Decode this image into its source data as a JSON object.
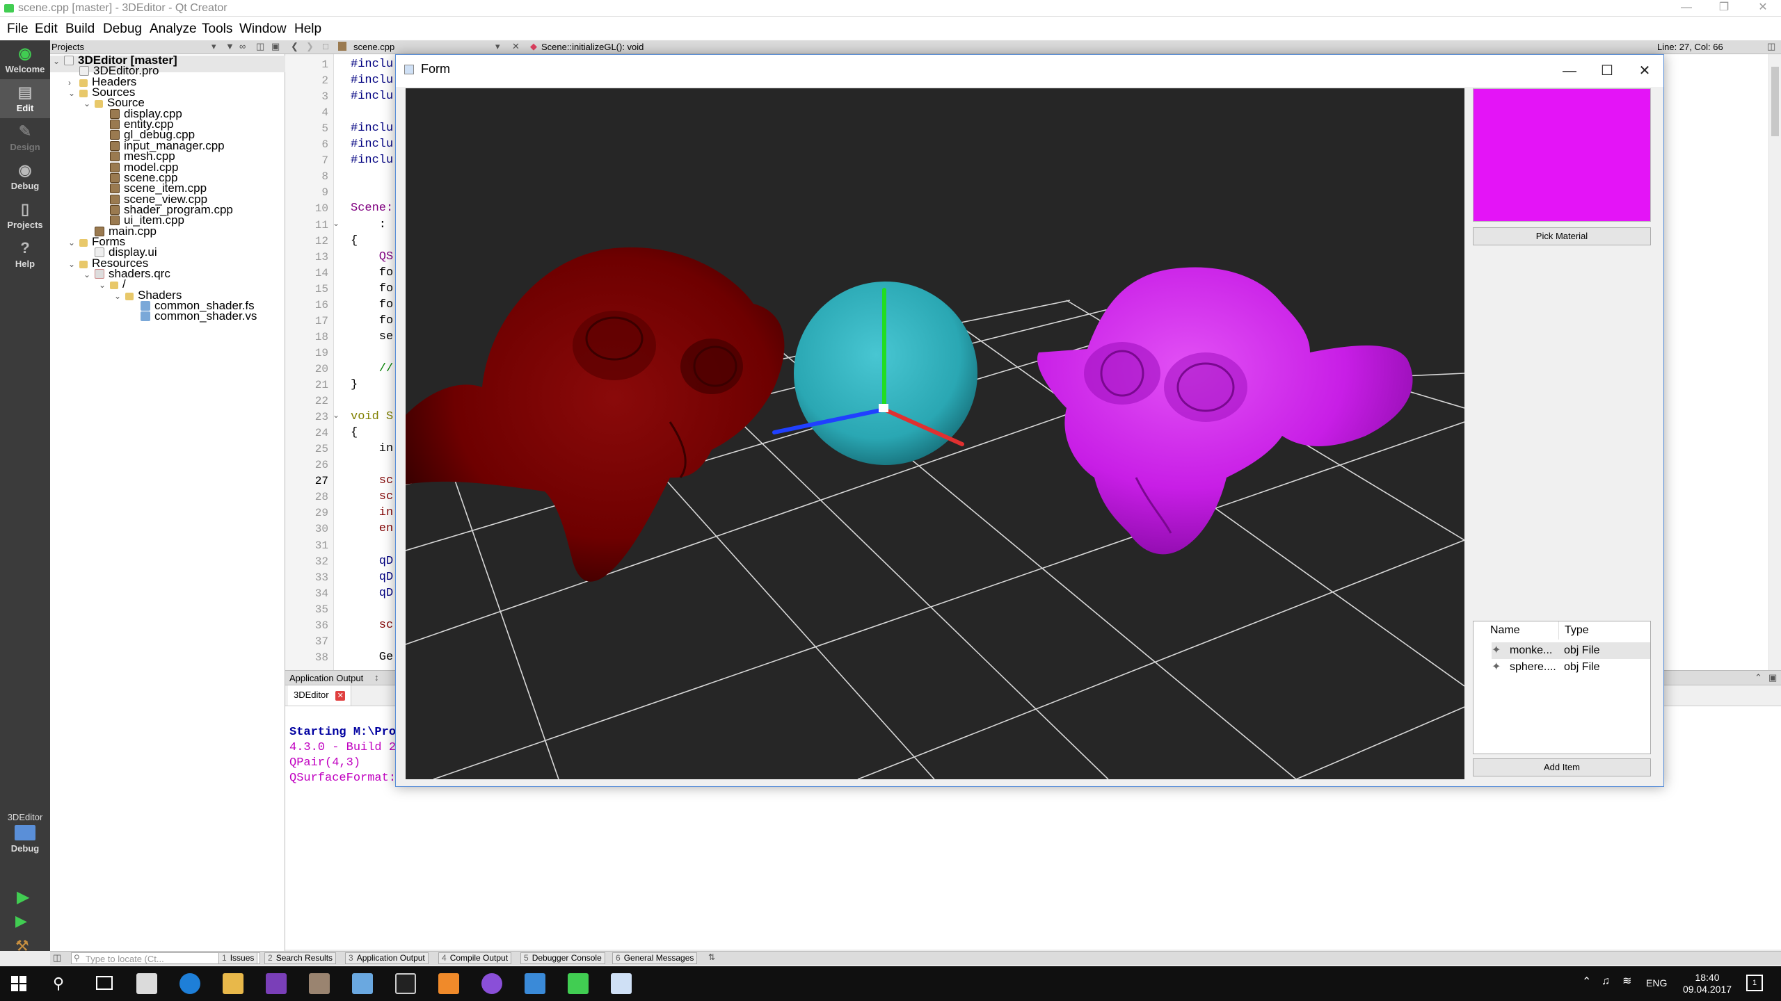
{
  "window": {
    "title": "scene.cpp [master] - 3DEditor - Qt Creator"
  },
  "menu": [
    "File",
    "Edit",
    "Build",
    "Debug",
    "Analyze",
    "Tools",
    "Window",
    "Help"
  ],
  "modes": [
    {
      "label": "Welcome",
      "icon": "qt-logo-icon"
    },
    {
      "label": "Edit",
      "icon": "edit-icon"
    },
    {
      "label": "Design",
      "icon": "design-icon"
    },
    {
      "label": "Debug",
      "icon": "debug-icon"
    },
    {
      "label": "Projects",
      "icon": "projects-icon"
    },
    {
      "label": "Help",
      "icon": "help-icon"
    }
  ],
  "kit": {
    "project": "3DEditor",
    "config": "Debug"
  },
  "projects_panel": {
    "title": "Projects",
    "tree": [
      {
        "label": "3DEditor [master]",
        "level": 0,
        "kind": "project",
        "expanded": true,
        "bold": true
      },
      {
        "label": "3DEditor.pro",
        "level": 1,
        "kind": "pro"
      },
      {
        "label": "Headers",
        "level": 1,
        "kind": "folder",
        "expanded": false
      },
      {
        "label": "Sources",
        "level": 1,
        "kind": "folder",
        "expanded": true
      },
      {
        "label": "Source",
        "level": 2,
        "kind": "folder",
        "expanded": true
      },
      {
        "label": "display.cpp",
        "level": 3,
        "kind": "file"
      },
      {
        "label": "entity.cpp",
        "level": 3,
        "kind": "file"
      },
      {
        "label": "gl_debug.cpp",
        "level": 3,
        "kind": "file"
      },
      {
        "label": "input_manager.cpp",
        "level": 3,
        "kind": "file"
      },
      {
        "label": "mesh.cpp",
        "level": 3,
        "kind": "file"
      },
      {
        "label": "model.cpp",
        "level": 3,
        "kind": "file"
      },
      {
        "label": "scene.cpp",
        "level": 3,
        "kind": "file"
      },
      {
        "label": "scene_item.cpp",
        "level": 3,
        "kind": "file"
      },
      {
        "label": "scene_view.cpp",
        "level": 3,
        "kind": "file"
      },
      {
        "label": "shader_program.cpp",
        "level": 3,
        "kind": "file"
      },
      {
        "label": "ui_item.cpp",
        "level": 3,
        "kind": "file"
      },
      {
        "label": "main.cpp",
        "level": 2,
        "kind": "file"
      },
      {
        "label": "Forms",
        "level": 1,
        "kind": "folder",
        "expanded": true
      },
      {
        "label": "display.ui",
        "level": 2,
        "kind": "ui"
      },
      {
        "label": "Resources",
        "level": 1,
        "kind": "folder",
        "expanded": true
      },
      {
        "label": "shaders.qrc",
        "level": 2,
        "kind": "qrc",
        "expanded": true
      },
      {
        "label": "/",
        "level": 3,
        "kind": "folder",
        "expanded": true
      },
      {
        "label": "Shaders",
        "level": 4,
        "kind": "folder",
        "expanded": true
      },
      {
        "label": "common_shader.fs",
        "level": 5,
        "kind": "shader"
      },
      {
        "label": "common_shader.vs",
        "level": 5,
        "kind": "shader"
      }
    ]
  },
  "editor": {
    "file_tab": "scene.cpp",
    "symbol": "Scene::initializeGL(): void",
    "cursor": "Line: 27, Col: 66",
    "lines": [
      {
        "n": "1",
        "text": "#inclu",
        "color": "#000080"
      },
      {
        "n": "2",
        "text": "#inclu",
        "color": "#000080"
      },
      {
        "n": "3",
        "text": "#inclu",
        "color": "#000080"
      },
      {
        "n": "4",
        "text": "",
        "color": "#000"
      },
      {
        "n": "5",
        "text": "#inclu",
        "color": "#000080"
      },
      {
        "n": "6",
        "text": "#inclu",
        "color": "#000080"
      },
      {
        "n": "7",
        "text": "#inclu",
        "color": "#000080"
      },
      {
        "n": "8",
        "text": "",
        "color": "#000"
      },
      {
        "n": "9",
        "text": "",
        "color": "#000"
      },
      {
        "n": "10",
        "text": "Scene:",
        "color": "#800080"
      },
      {
        "n": "11",
        "text": "    :",
        "color": "#000"
      },
      {
        "n": "12",
        "text": "{",
        "color": "#000"
      },
      {
        "n": "13",
        "text": "    QS",
        "color": "#800080"
      },
      {
        "n": "14",
        "text": "    fo",
        "color": "#000"
      },
      {
        "n": "15",
        "text": "    fo",
        "color": "#000"
      },
      {
        "n": "16",
        "text": "    fo",
        "color": "#000"
      },
      {
        "n": "17",
        "text": "    fo",
        "color": "#000"
      },
      {
        "n": "18",
        "text": "    se",
        "color": "#000"
      },
      {
        "n": "19",
        "text": "",
        "color": "#000"
      },
      {
        "n": "20",
        "text": "    //",
        "color": "#008000"
      },
      {
        "n": "21",
        "text": "}",
        "color": "#000"
      },
      {
        "n": "22",
        "text": "",
        "color": "#000"
      },
      {
        "n": "23",
        "text": "void S",
        "color": "#808000"
      },
      {
        "n": "24",
        "text": "{",
        "color": "#000"
      },
      {
        "n": "25",
        "text": "    in",
        "color": "#000"
      },
      {
        "n": "26",
        "text": "",
        "color": "#000"
      },
      {
        "n": "27",
        "text": "    sc",
        "color": "#800000"
      },
      {
        "n": "28",
        "text": "    sc",
        "color": "#800000"
      },
      {
        "n": "29",
        "text": "    in",
        "color": "#800000"
      },
      {
        "n": "30",
        "text": "    en",
        "color": "#800000"
      },
      {
        "n": "31",
        "text": "",
        "color": "#000"
      },
      {
        "n": "32",
        "text": "    qD",
        "color": "#000080"
      },
      {
        "n": "33",
        "text": "    qD",
        "color": "#000080"
      },
      {
        "n": "34",
        "text": "    qD",
        "color": "#000080"
      },
      {
        "n": "35",
        "text": "",
        "color": "#000"
      },
      {
        "n": "36",
        "text": "    sc",
        "color": "#800000"
      },
      {
        "n": "37",
        "text": "",
        "color": "#000"
      },
      {
        "n": "38",
        "text": "    Ge",
        "color": "#000"
      }
    ]
  },
  "output": {
    "title": "Application Output",
    "tab": "3DEditor",
    "lines": [
      {
        "text": "Starting M:\\Pro",
        "color": "#0000a0",
        "bold": true
      },
      {
        "text": "4.3.0 - Build 2",
        "color": "#c000c0",
        "bold": false
      },
      {
        "text": "QPair(4,3)",
        "color": "#c000c0",
        "bold": false
      },
      {
        "text": "QSurfaceFormat:",
        "color": "#c000c0",
        "bold": false
      }
    ]
  },
  "locator": {
    "placeholder": "Type to locate (Ct...",
    "tabs": [
      {
        "num": "1",
        "label": "Issues"
      },
      {
        "num": "2",
        "label": "Search Results"
      },
      {
        "num": "3",
        "label": "Application Output"
      },
      {
        "num": "4",
        "label": "Compile Output"
      },
      {
        "num": "5",
        "label": "Debugger Console"
      },
      {
        "num": "6",
        "label": "General Messages"
      }
    ]
  },
  "form": {
    "title": "Form",
    "material_color": "#e414f7",
    "pick_material": "Pick Material",
    "add_item": "Add Item",
    "columns": [
      "Name",
      "Type"
    ],
    "items": [
      {
        "name": "monke...",
        "type": "obj File",
        "selected": true
      },
      {
        "name": "sphere....",
        "type": "obj File",
        "selected": false
      }
    ]
  },
  "scene": {
    "background": "#262626",
    "left_model_color": "#6e0000",
    "right_model_color": "#c81ee6",
    "sphere_color": "#2aa7b3",
    "axis_colors": {
      "x": "#e03030",
      "y": "#22dd22",
      "z": "#2040ff"
    }
  },
  "taskbar": {
    "time": "18:40",
    "date": "09.04.2017",
    "lang": "ENG",
    "notifications": "1",
    "apps": [
      "start-icon",
      "search-icon",
      "task-view-icon",
      "store-icon",
      "edge-icon",
      "explorer-icon",
      "visual-studio-icon",
      "app-icon",
      "3d-builder-icon",
      "terminal-icon",
      "paint-icon",
      "github-icon",
      "app-icon",
      "qt-creator-icon",
      "form-app-icon"
    ]
  }
}
